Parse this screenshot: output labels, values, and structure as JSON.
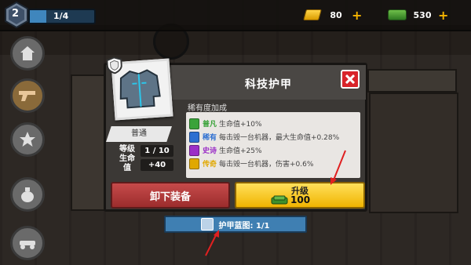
{
  "topbar": {
    "level": "2",
    "xp_text": "1/4",
    "xp_progress": 0.25,
    "gold_amount": "80",
    "cash_amount": "530"
  },
  "dialog": {
    "title": "科技护甲",
    "rarity": "普通",
    "stat_labels": "等级\n生命\n值",
    "level_value": "1 / 10",
    "hp_value": "+40",
    "rarity_bonus_header": "稀有度加成",
    "bonuses": [
      {
        "name": "普凡",
        "text": "生命值+10%",
        "color": "#3aa33a"
      },
      {
        "name": "稀有",
        "text": "每击毁一台机器，最大生命值+0.28%",
        "color": "#2d6fd1"
      },
      {
        "name": "史诗",
        "text": "生命值+25%",
        "color": "#9b2fc7"
      },
      {
        "name": "传奇",
        "text": "每击毁一台机器，伤害+0.6%",
        "color": "#e0a800"
      }
    ],
    "unequip_label": "卸下装备",
    "upgrade_label": "升级",
    "upgrade_cost": "100"
  },
  "blueprint": {
    "text": "护甲蓝图: 1/1"
  },
  "colors": {
    "annotation_arrow": "#e02020",
    "upgrade_button": "#f5c518",
    "unequip_button": "#b23a3a",
    "close_button": "#d8242a"
  }
}
